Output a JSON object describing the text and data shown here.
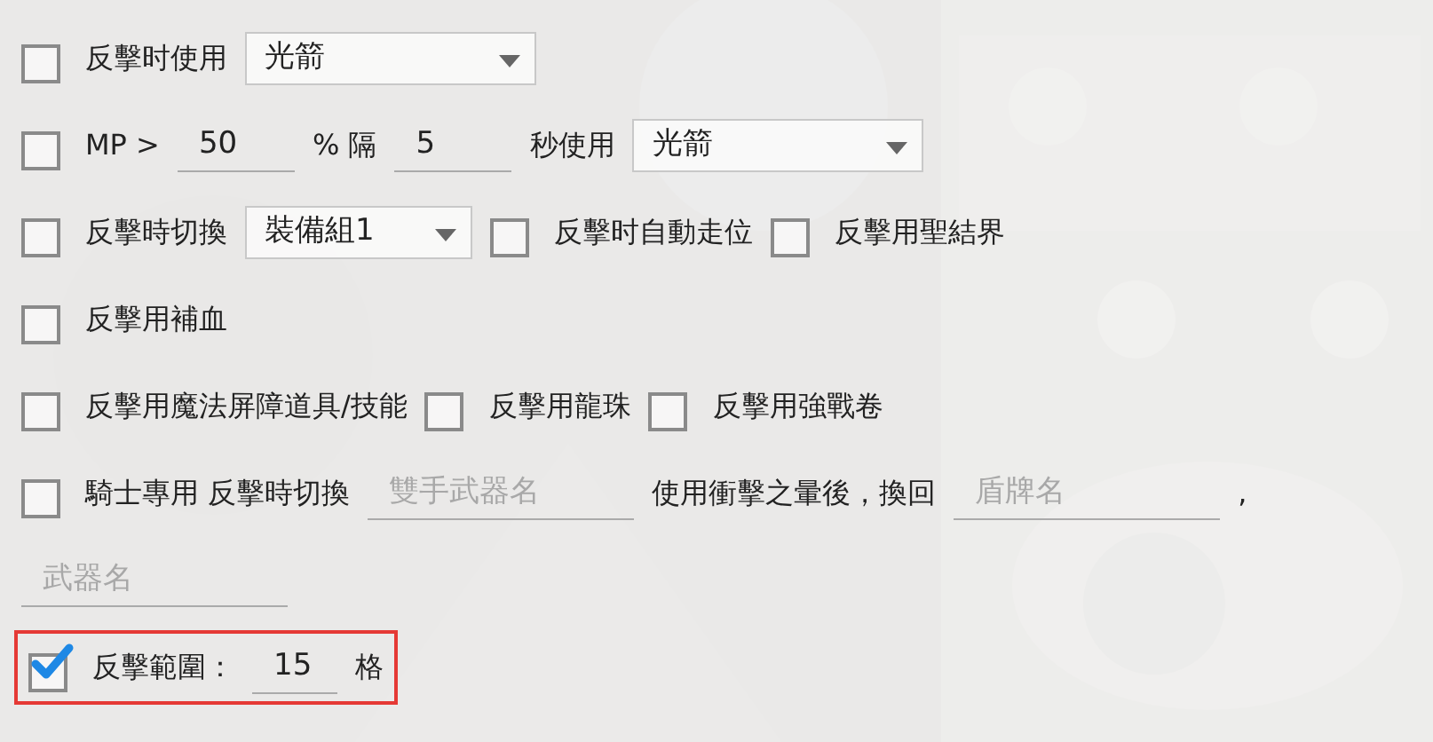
{
  "rows": [
    {
      "highlighted": false,
      "items": [
        {
          "kind": "checkbox",
          "checked": false,
          "label": "反擊时使用"
        },
        {
          "kind": "dropdown",
          "value": "光箭"
        }
      ]
    },
    {
      "highlighted": false,
      "items": [
        {
          "kind": "checkbox",
          "checked": false,
          "label": "MP >"
        },
        {
          "kind": "input",
          "value": "50"
        },
        {
          "kind": "text",
          "text": "% 隔"
        },
        {
          "kind": "input",
          "value": "5"
        },
        {
          "kind": "text",
          "text": "秒使用"
        },
        {
          "kind": "dropdown",
          "value": "光箭"
        }
      ]
    },
    {
      "highlighted": false,
      "items": [
        {
          "kind": "checkbox",
          "checked": false,
          "label": "反擊時切換"
        },
        {
          "kind": "dropdown",
          "value": "裝備組1"
        },
        {
          "kind": "checkbox",
          "checked": false,
          "label": "反擊时自動走位"
        },
        {
          "kind": "checkbox",
          "checked": false,
          "label": "反擊用聖結界"
        }
      ]
    },
    {
      "highlighted": false,
      "items": [
        {
          "kind": "checkbox",
          "checked": false,
          "label": "反擊用補血"
        }
      ]
    },
    {
      "highlighted": false,
      "items": [
        {
          "kind": "checkbox",
          "checked": false,
          "label": "反擊用魔法屏障道具/技能"
        },
        {
          "kind": "checkbox",
          "checked": false,
          "label": "反擊用龍珠"
        },
        {
          "kind": "checkbox",
          "checked": false,
          "label": "反擊用強戰卷"
        }
      ]
    },
    {
      "highlighted": false,
      "items": [
        {
          "kind": "checkbox",
          "checked": false,
          "label": "騎士專用 反擊時切換"
        },
        {
          "kind": "input",
          "placeholder": "雙手武器名"
        },
        {
          "kind": "text",
          "text": "使用衝擊之暈後，換回"
        },
        {
          "kind": "input",
          "placeholder": "盾牌名"
        },
        {
          "kind": "text",
          "text": ","
        }
      ]
    },
    {
      "highlighted": false,
      "items": [
        {
          "kind": "input",
          "placeholder": "武器名"
        }
      ]
    },
    {
      "highlighted": true,
      "items": [
        {
          "kind": "checkbox",
          "checked": true,
          "label": "反擊範圍："
        },
        {
          "kind": "input",
          "value": "15"
        },
        {
          "kind": "text",
          "text": "格"
        }
      ]
    }
  ]
}
